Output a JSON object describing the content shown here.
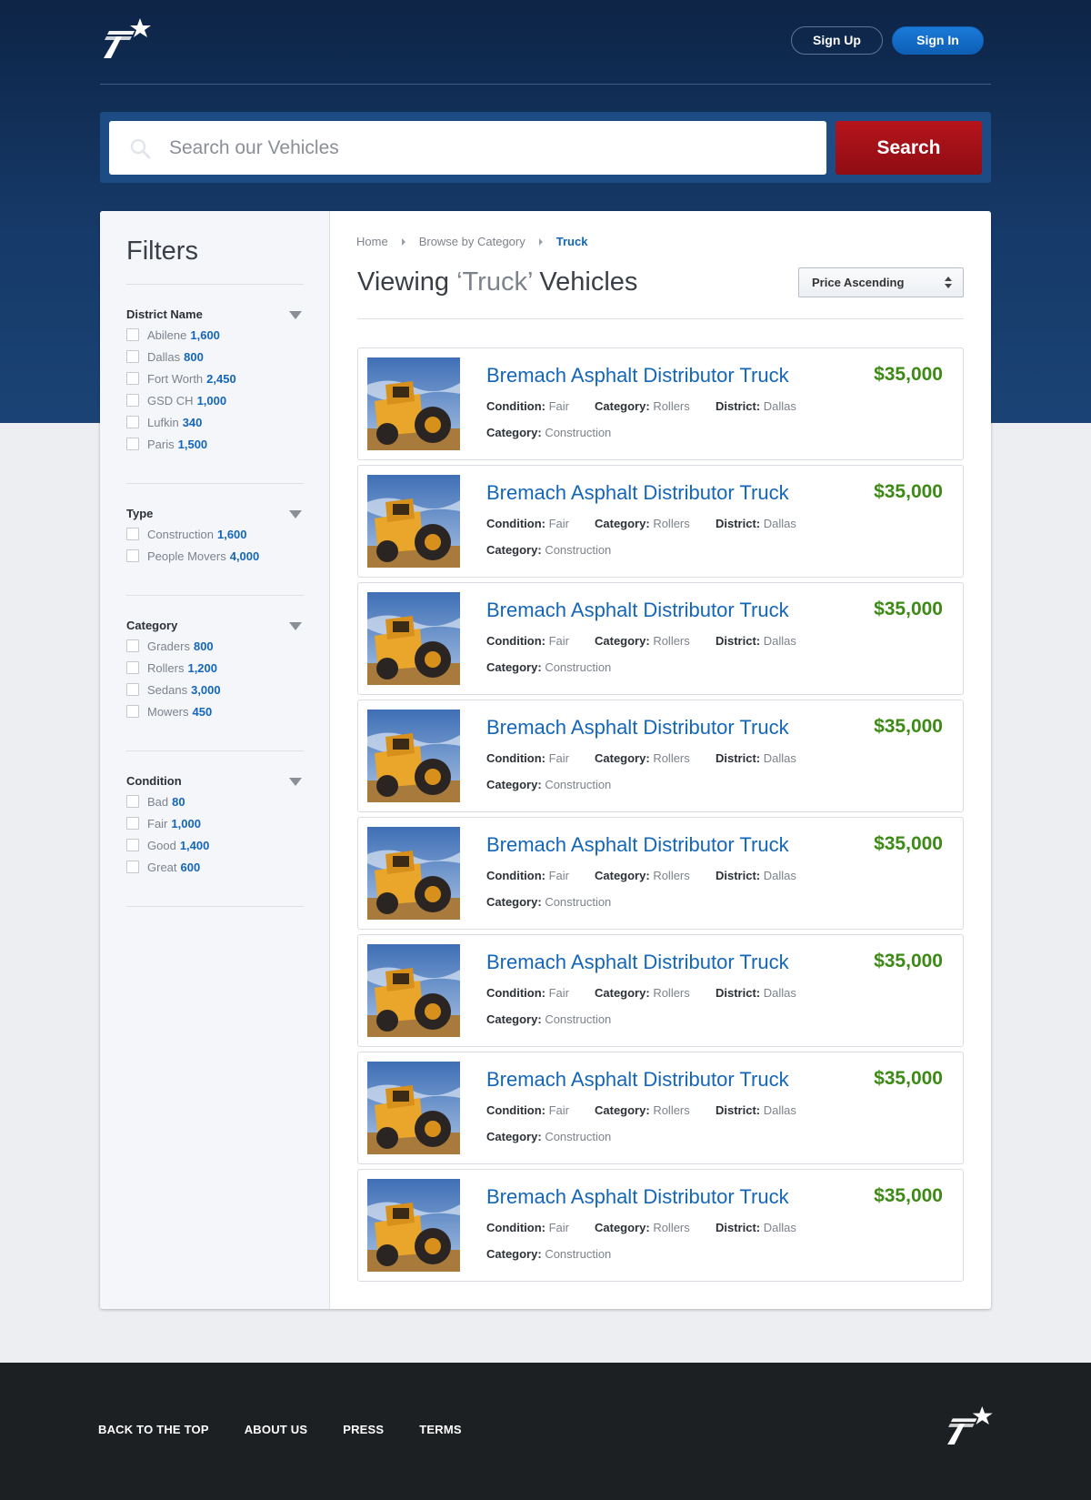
{
  "header": {
    "signup_label": "Sign Up",
    "signin_label": "Sign In"
  },
  "search": {
    "placeholder": "Search our Vehicles",
    "button_label": "Search"
  },
  "filters": {
    "title": "Filters",
    "groups": [
      {
        "title": "District Name",
        "items": [
          {
            "label": "Abilene",
            "count": "1,600"
          },
          {
            "label": "Dallas",
            "count": "800"
          },
          {
            "label": "Fort Worth",
            "count": "2,450"
          },
          {
            "label": "GSD CH",
            "count": "1,000"
          },
          {
            "label": "Lufkin",
            "count": "340"
          },
          {
            "label": "Paris",
            "count": "1,500"
          }
        ]
      },
      {
        "title": "Type",
        "items": [
          {
            "label": "Construction",
            "count": "1,600"
          },
          {
            "label": "People Movers",
            "count": "4,000"
          }
        ]
      },
      {
        "title": "Category",
        "items": [
          {
            "label": "Graders",
            "count": "800"
          },
          {
            "label": "Rollers",
            "count": "1,200"
          },
          {
            "label": "Sedans",
            "count": "3,000"
          },
          {
            "label": "Mowers",
            "count": "450"
          }
        ]
      },
      {
        "title": "Condition",
        "items": [
          {
            "label": "Bad",
            "count": "80"
          },
          {
            "label": "Fair",
            "count": "1,000"
          },
          {
            "label": "Good",
            "count": "1,400"
          },
          {
            "label": "Great",
            "count": "600"
          }
        ]
      }
    ]
  },
  "breadcrumb": {
    "home": "Home",
    "browse": "Browse by Category",
    "current": "Truck"
  },
  "results_header": {
    "title_prefix": "Viewing ",
    "title_query": "‘Truck’",
    "title_suffix": " Vehicles",
    "sort_value": "Price Ascending"
  },
  "meta_labels": {
    "condition": "Condition:",
    "category": "Category:",
    "district": "District:"
  },
  "listings": [
    {
      "title": "Bremach Asphalt Distributor Truck",
      "price": "$35,000",
      "condition": "Fair",
      "category": "Rollers",
      "district": "Dallas",
      "category2": "Construction"
    },
    {
      "title": "Bremach Asphalt Distributor Truck",
      "price": "$35,000",
      "condition": "Fair",
      "category": "Rollers",
      "district": "Dallas",
      "category2": "Construction"
    },
    {
      "title": "Bremach Asphalt Distributor Truck",
      "price": "$35,000",
      "condition": "Fair",
      "category": "Rollers",
      "district": "Dallas",
      "category2": "Construction"
    },
    {
      "title": "Bremach Asphalt Distributor Truck",
      "price": "$35,000",
      "condition": "Fair",
      "category": "Rollers",
      "district": "Dallas",
      "category2": "Construction"
    },
    {
      "title": "Bremach Asphalt Distributor Truck",
      "price": "$35,000",
      "condition": "Fair",
      "category": "Rollers",
      "district": "Dallas",
      "category2": "Construction"
    },
    {
      "title": "Bremach Asphalt Distributor Truck",
      "price": "$35,000",
      "condition": "Fair",
      "category": "Rollers",
      "district": "Dallas",
      "category2": "Construction"
    },
    {
      "title": "Bremach Asphalt Distributor Truck",
      "price": "$35,000",
      "condition": "Fair",
      "category": "Rollers",
      "district": "Dallas",
      "category2": "Construction"
    },
    {
      "title": "Bremach Asphalt Distributor Truck",
      "price": "$35,000",
      "condition": "Fair",
      "category": "Rollers",
      "district": "Dallas",
      "category2": "Construction"
    }
  ],
  "footer": {
    "links": [
      "BACK TO THE TOP",
      "ABOUT US",
      "PRESS",
      "TERMS"
    ]
  },
  "colors": {
    "brand_navy": "#0d2446",
    "accent_blue": "#1466b8",
    "search_red": "#b6141c",
    "price_green": "#3e8a16",
    "footer_bg": "#1d2023"
  },
  "icons": {
    "logo": "star-logo-icon",
    "search": "search-icon",
    "toggle": "triangle-down-icon",
    "breadcrumb_sep": "chevron-right-icon",
    "sort": "up-down-arrows-icon"
  }
}
